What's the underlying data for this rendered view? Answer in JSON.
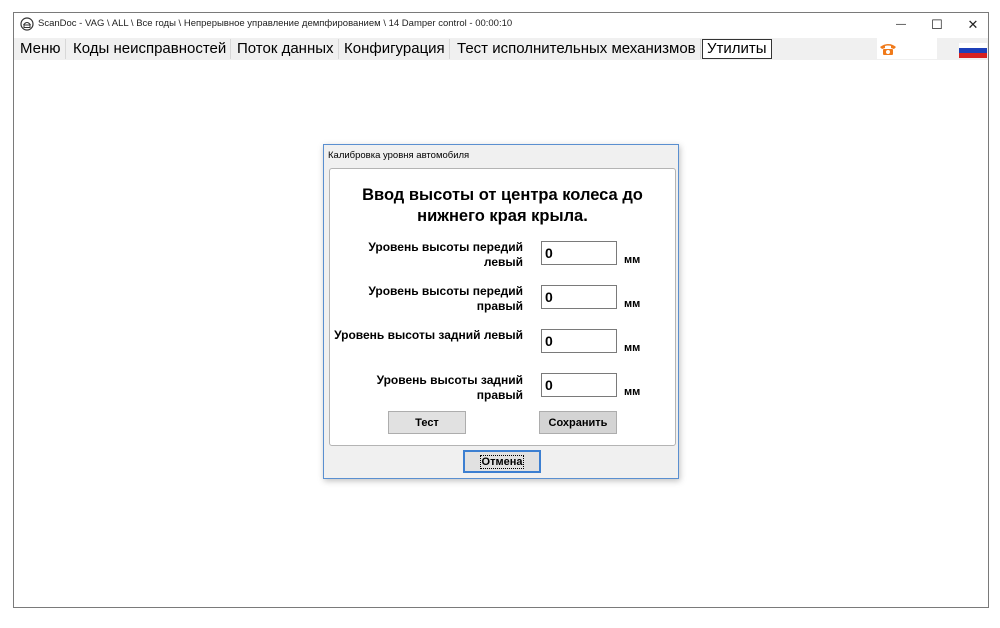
{
  "window": {
    "title": "ScanDoc - VAG \\ ALL \\ Все годы \\ Непрерывное управление демпфированием \\ 14 Damper control - 00:00:10",
    "controls": {
      "minimize": "—",
      "maximize": "☐",
      "close": "✕"
    }
  },
  "menu": {
    "items": [
      {
        "label": "Меню"
      },
      {
        "label": "Коды неисправностей"
      },
      {
        "label": "Поток данных"
      },
      {
        "label": "Конфигурация"
      },
      {
        "label": "Тест исполнительных механизмов"
      },
      {
        "label": "Утилиты"
      }
    ],
    "icons": {
      "phone": "phone-icon",
      "flag": "russian-flag-icon"
    },
    "accent_color": "#f07a1a"
  },
  "dialog": {
    "title": "Калибровка уровня автомобиля",
    "heading": "Ввод высоты от центра колеса до нижнего края крыла.",
    "rows": [
      {
        "label": "Уровень высоты передий левый",
        "value": "0",
        "unit": "мм"
      },
      {
        "label": "Уровень высоты передий правый",
        "value": "0",
        "unit": "мм"
      },
      {
        "label": "Уровень высоты задний левый",
        "value": "0",
        "unit": "мм"
      },
      {
        "label": "Уровень высоты задний правый",
        "value": "0",
        "unit": "мм"
      }
    ],
    "test_label": "Тест",
    "save_label": "Сохранить",
    "cancel_label": "Отмена",
    "border_color": "#5a8fd0"
  }
}
